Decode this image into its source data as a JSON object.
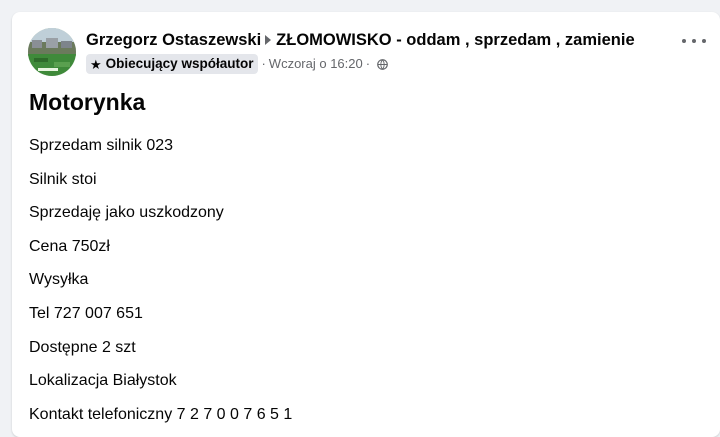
{
  "post": {
    "author": "Grzegorz Ostaszewski",
    "group": "ZŁOMOWISKO - oddam , sprzedam , zamienie",
    "badge_label": "Obiecujący współautor",
    "badge_icon": "star-icon",
    "separator": "·",
    "timestamp": "Wczoraj o 16:20",
    "privacy_icon": "globe-icon",
    "title": "Motorynka",
    "lines": [
      "Sprzedam silnik 023",
      "Silnik stoi",
      "Sprzedaję jako uszkodzony",
      "Cena 750zł",
      "Wysyłka",
      "Tel 727 007 651",
      "Dostępne 2 szt",
      "Lokalizacja Białystok",
      "Kontakt telefoniczny 7 2 7 0 0 7 6 5 1"
    ]
  },
  "colors": {
    "background": "#f0f2f5",
    "card": "#ffffff",
    "text_primary": "#050505",
    "text_secondary": "#65676b",
    "badge_bg": "#e4e6eb"
  }
}
